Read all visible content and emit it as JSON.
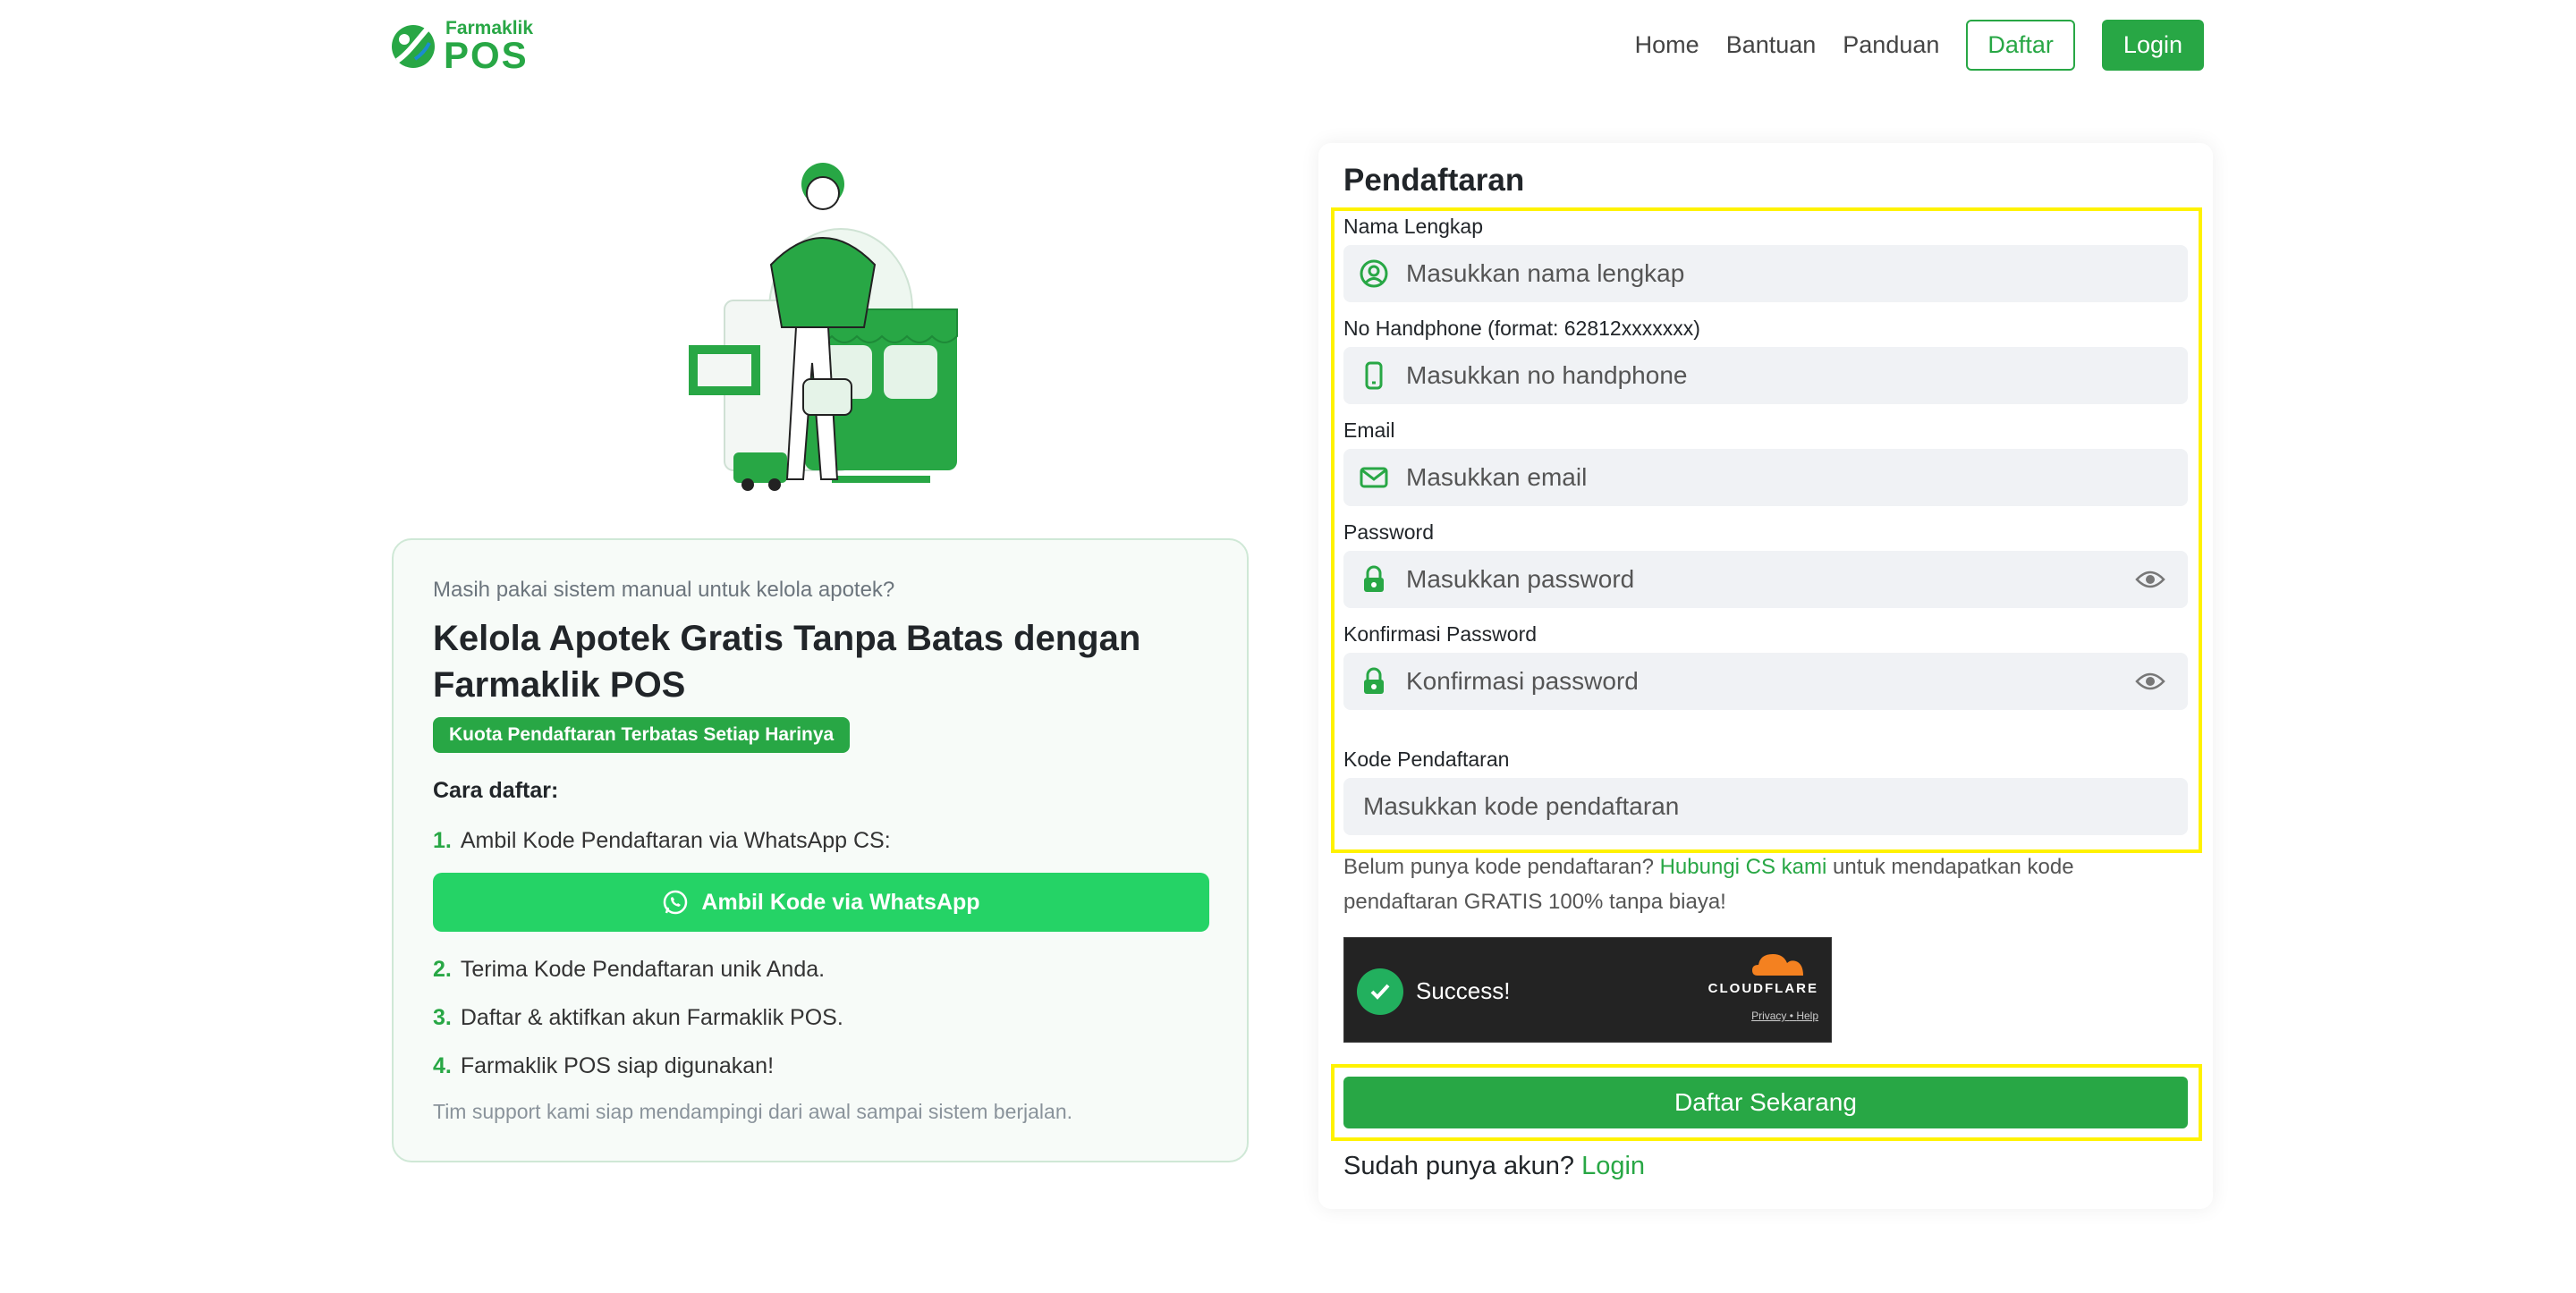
{
  "brand": {
    "top": "Farmaklik",
    "bottom": "POS"
  },
  "nav": {
    "home": "Home",
    "help": "Bantuan",
    "guide": "Panduan",
    "register": "Daftar",
    "login": "Login"
  },
  "info": {
    "question": "Masih pakai sistem manual untuk kelola apotek?",
    "title": "Kelola Apotek Gratis Tanpa Batas dengan Farmaklik POS",
    "badge": "Kuota Pendaftaran Terbatas Setiap Harinya",
    "steps_heading": "Cara daftar:",
    "steps": [
      {
        "num": "1.",
        "text": "Ambil Kode Pendaftaran via WhatsApp CS:"
      },
      {
        "num": "2.",
        "text": "Terima Kode Pendaftaran unik Anda."
      },
      {
        "num": "3.",
        "text": "Daftar & aktifkan akun Farmaklik POS."
      },
      {
        "num": "4.",
        "text": "Farmaklik POS siap digunakan!"
      }
    ],
    "whatsapp_button": "Ambil Kode via WhatsApp",
    "support": "Tim support kami siap mendampingi dari awal sampai sistem berjalan."
  },
  "form": {
    "title": "Pendaftaran",
    "fields": {
      "name": {
        "label": "Nama Lengkap",
        "placeholder": "Masukkan nama lengkap",
        "value": ""
      },
      "phone": {
        "label": "No Handphone (format: 62812xxxxxxx)",
        "placeholder": "Masukkan no handphone",
        "value": ""
      },
      "email": {
        "label": "Email",
        "placeholder": "Masukkan email",
        "value": ""
      },
      "password": {
        "label": "Password",
        "placeholder": "Masukkan password",
        "value": ""
      },
      "confirm": {
        "label": "Konfirmasi Password",
        "placeholder": "Konfirmasi password",
        "value": ""
      },
      "code": {
        "label": "Kode Pendaftaran",
        "placeholder": "Masukkan kode pendaftaran",
        "value": ""
      }
    },
    "help_prefix": "Belum punya kode pendaftaran?",
    "help_link": "Hubungi CS kami",
    "help_suffix": "untuk mendapatkan kode pendaftaran GRATIS 100% tanpa biaya!",
    "captcha": {
      "status": "Success!",
      "brand": "CLOUDFLARE",
      "privacy": "Privacy",
      "separator": "•",
      "help": "Help"
    },
    "submit": "Daftar Sekarang",
    "login_prompt": "Sudah punya akun?",
    "login_link": "Login"
  },
  "colors": {
    "brand_green": "#28a745",
    "whatsapp_green": "#25d366",
    "highlight": "#fff200",
    "cloudflare_orange": "#f48120"
  },
  "icons": [
    "logo-leaf-icon",
    "user-circle-icon",
    "phone-icon",
    "mail-icon",
    "lock-icon",
    "eye-icon",
    "whatsapp-icon",
    "check-icon",
    "cloud-icon"
  ]
}
